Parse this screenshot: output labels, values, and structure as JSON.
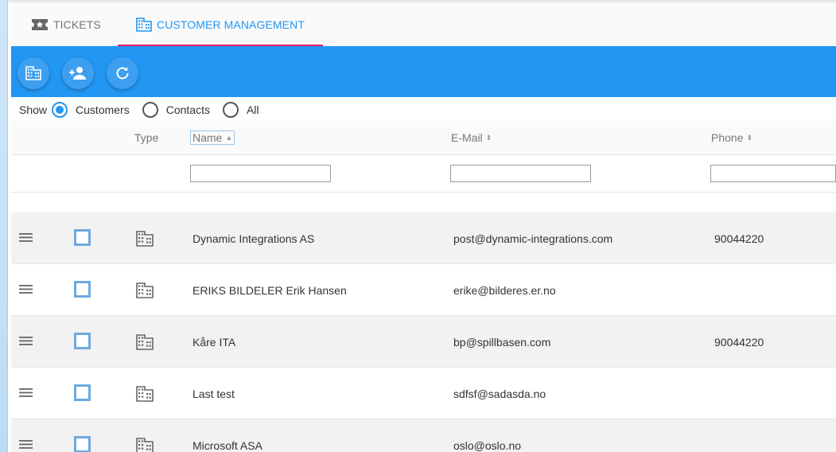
{
  "tabs": [
    {
      "label": "TICKETS",
      "icon": "ticket-star-icon",
      "active": false
    },
    {
      "label": "CUSTOMER MANAGEMENT",
      "icon": "building-icon",
      "active": true
    }
  ],
  "toolbar": {
    "buttons": [
      {
        "icon": "building-icon"
      },
      {
        "icon": "add-person-icon"
      },
      {
        "icon": "refresh-icon"
      }
    ]
  },
  "show_filter": {
    "label": "Show",
    "options": [
      "Customers",
      "Contacts",
      "All"
    ],
    "selected": "Customers"
  },
  "table": {
    "columns": {
      "type": "Type",
      "name": "Name",
      "email": "E-Mail",
      "phone": "Phone"
    },
    "rows": [
      {
        "name": "Dynamic Integrations AS",
        "email": "post@dynamic-integrations.com",
        "phone": "90044220"
      },
      {
        "name": "ERIKS BILDELER Erik Hansen",
        "email": "erike@bilderes.er.no",
        "phone": ""
      },
      {
        "name": "Kåre ITA",
        "email": "bp@spillbasen.com",
        "phone": "90044220"
      },
      {
        "name": "Last test",
        "email": "sdfsf@sadasda.no",
        "phone": ""
      },
      {
        "name": "Microsoft ASA",
        "email": "oslo@oslo.no",
        "phone": ""
      }
    ]
  },
  "colors": {
    "primary": "#2196f3",
    "accent": "#e91e63"
  }
}
